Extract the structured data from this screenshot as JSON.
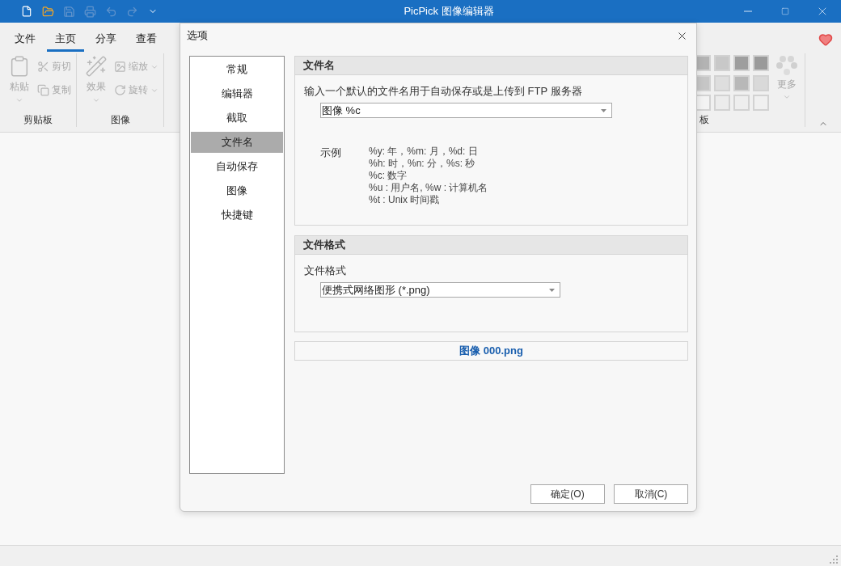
{
  "app": {
    "title": "PicPick 图像编辑器",
    "quick_access": [
      {
        "kind": "new",
        "disabled": false
      },
      {
        "kind": "open",
        "disabled": false
      },
      {
        "kind": "save",
        "disabled": true
      },
      {
        "kind": "print",
        "disabled": true
      },
      {
        "kind": "undo",
        "disabled": true
      },
      {
        "kind": "redo",
        "disabled": true
      },
      {
        "kind": "customize",
        "disabled": false
      }
    ]
  },
  "ribbon": {
    "tabs": [
      {
        "label": "文件",
        "selected": false
      },
      {
        "label": "主页",
        "selected": true
      },
      {
        "label": "分享",
        "selected": false
      },
      {
        "label": "查看",
        "selected": false
      }
    ],
    "groups": [
      {
        "label": "剪贴板",
        "large": {
          "kind": "paste",
          "label": "粘贴",
          "disabled": true
        },
        "small": [
          {
            "kind": "cut",
            "label": "剪切",
            "disabled": true,
            "dropdown": false
          },
          {
            "kind": "copy",
            "label": "复制",
            "disabled": true,
            "dropdown": false
          }
        ]
      },
      {
        "label": "图像",
        "large": {
          "kind": "effects",
          "label": "效果",
          "disabled": true
        },
        "small": [
          {
            "kind": "resize",
            "label": "缩放",
            "disabled": true,
            "dropdown": true
          },
          {
            "kind": "rotate",
            "label": "旋转",
            "disabled": true,
            "dropdown": true
          }
        ]
      }
    ],
    "swatch_group": {
      "label": "板",
      "swatches": [
        {
          "color": "#b3b3b3"
        },
        {
          "color": "#c8c8c8"
        },
        {
          "color": "#9e9e9e"
        },
        {
          "color": "#9a9a9a"
        },
        {
          "color": "#c6c6c6"
        },
        {
          "color": "#dedede"
        },
        {
          "color": "#b8b8b8"
        },
        {
          "color": "#d9d9d9"
        },
        {
          "color": "#f3f3f3"
        },
        {
          "color": "#ececec"
        },
        {
          "color": "#eeeeee"
        },
        {
          "color": "#f0f0f0"
        }
      ],
      "more": {
        "label": "更多",
        "disabled": true
      }
    }
  },
  "dialog": {
    "title": "选项",
    "nav": [
      {
        "label": "常规",
        "selected": false
      },
      {
        "label": "编辑器",
        "selected": false
      },
      {
        "label": "截取",
        "selected": false
      },
      {
        "label": "文件名",
        "selected": true
      },
      {
        "label": "自动保存",
        "selected": false
      },
      {
        "label": "图像",
        "selected": false
      },
      {
        "label": "快捷键",
        "selected": false
      }
    ],
    "filename_section": {
      "title": "文件名",
      "description": "输入一个默认的文件名用于自动保存或是上传到 FTP 服务器",
      "value": "图像 %c",
      "examples_label": "示例",
      "examples": [
        "%y: 年，%m: 月，%d: 日",
        "%h: 时，%n: 分，%s: 秒",
        "%c: 数字",
        "%u : 用户名, %w : 计算机名",
        "%t : Unix 时间戳"
      ]
    },
    "format_section": {
      "title": "文件格式",
      "label": "文件格式",
      "value": "便携式网络图形 (*.png)"
    },
    "preview": "图像 000.png",
    "buttons": [
      "确定(O)",
      "取消(C)"
    ]
  }
}
